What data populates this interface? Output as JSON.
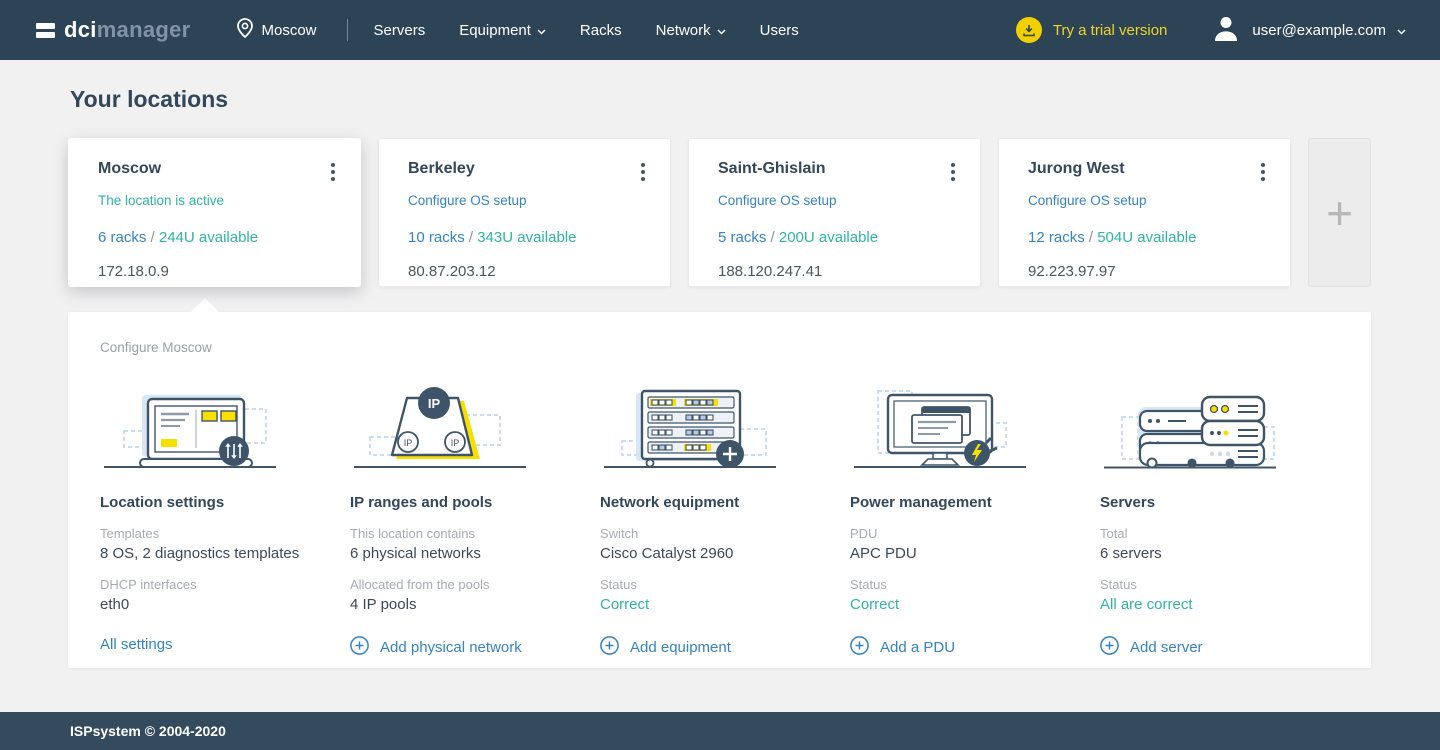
{
  "navbar": {
    "logo": {
      "bold": "dci",
      "light": "manager"
    },
    "current_location": "Moscow",
    "items": [
      {
        "label": "Servers",
        "has_dropdown": false
      },
      {
        "label": "Equipment",
        "has_dropdown": true
      },
      {
        "label": "Racks",
        "has_dropdown": false
      },
      {
        "label": "Network",
        "has_dropdown": true
      },
      {
        "label": "Users",
        "has_dropdown": false
      }
    ],
    "trial_label": "Try a trial version",
    "user_email": "user@example.com"
  },
  "page": {
    "title": "Your locations"
  },
  "racks_separator": "/",
  "locations": [
    {
      "name": "Moscow",
      "status": "The location is active",
      "racks": "6 racks",
      "available": "244U available",
      "ip": "172.18.0.9"
    },
    {
      "name": "Berkeley",
      "status": "Configure OS setup",
      "racks": "10 racks",
      "available": "343U available",
      "ip": "80.87.203.12"
    },
    {
      "name": "Saint-Ghislain",
      "status": "Configure OS setup",
      "racks": "5 racks",
      "available": "200U available",
      "ip": "188.120.247.41"
    },
    {
      "name": "Jurong West",
      "status": "Configure OS setup",
      "racks": "12 racks",
      "available": "504U available",
      "ip": "92.223.97.97"
    }
  ],
  "add_location": {
    "plus_label": "+"
  },
  "configure_panel": {
    "title": "Configure Moscow",
    "sections": [
      {
        "title": "Location settings",
        "icon": "laptop-settings-illustration",
        "rows": [
          {
            "label": "Templates",
            "value": "8 OS, 2 diagnostics templates"
          },
          {
            "label": "DHCP interfaces",
            "value": "eth0"
          }
        ],
        "action": "All settings"
      },
      {
        "title": "IP ranges and pools",
        "icon": "ip-pools-illustration",
        "rows": [
          {
            "label": "This location contains",
            "value": "6 physical networks"
          },
          {
            "label": "Allocated from the pools",
            "value": "4 IP pools"
          }
        ],
        "action": "Add physical network"
      },
      {
        "title": "Network equipment",
        "icon": "switch-illustration",
        "rows": [
          {
            "label": "Switch",
            "value": "Cisco Catalyst 2960"
          },
          {
            "label": "Status",
            "value": "Correct"
          }
        ],
        "action": "Add equipment"
      },
      {
        "title": "Power management",
        "icon": "power-monitor-illustration",
        "rows": [
          {
            "label": "PDU",
            "value": "APC PDU"
          },
          {
            "label": "Status",
            "value": "Correct"
          }
        ],
        "action": "Add a PDU"
      },
      {
        "title": "Servers",
        "icon": "servers-illustration",
        "rows": [
          {
            "label": "Total",
            "value": "6 servers"
          },
          {
            "label": "Status",
            "value": "All are correct"
          }
        ],
        "action": "Add server"
      }
    ]
  },
  "footer": {
    "copyright": "ISPsystem © 2004-2020"
  },
  "colors": {
    "navbar_bg": "#2d4456",
    "footer_bg": "#344b5e",
    "accent_blue": "#3583c0",
    "accent_teal": "#2fb3a2",
    "accent_yellow": "#f2d000",
    "illustration_yellow": "#f9df00"
  }
}
